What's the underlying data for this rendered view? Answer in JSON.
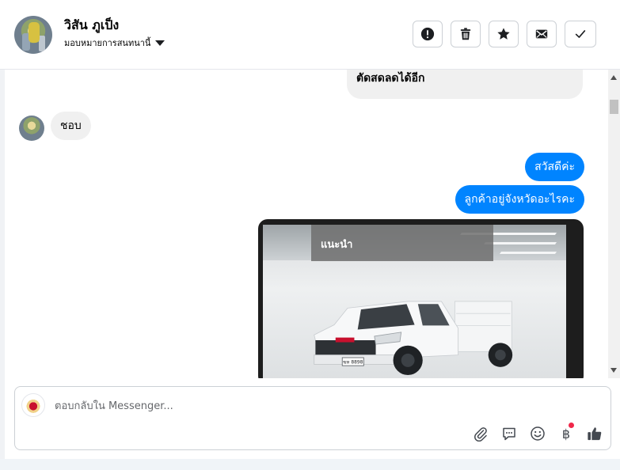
{
  "header": {
    "name": "วิสัน ภูเป็ง",
    "assign_label": "มอบหมายการสนทนานี้",
    "actions": [
      {
        "id": "mark-spam",
        "icon": "alert-icon"
      },
      {
        "id": "delete",
        "icon": "trash-icon"
      },
      {
        "id": "star",
        "icon": "star-icon"
      },
      {
        "id": "mark-unread",
        "icon": "envelope-icon"
      },
      {
        "id": "mark-done",
        "icon": "check-icon"
      }
    ]
  },
  "messages": [
    {
      "from": "customer-cut",
      "text": "ตัดสดลดได้อีก"
    },
    {
      "from": "contact",
      "text": "ชอบ"
    },
    {
      "from": "page",
      "text": "สวัสดีค่ะ"
    },
    {
      "from": "page",
      "text": "ลูกค้าอยู่จังหวัดอะไรคะ"
    }
  ],
  "card": {
    "badge": "แนะนำ",
    "plate_text": "ฆห 8898"
  },
  "composer": {
    "placeholder": "ตอบกลับใน Messenger...",
    "tools": [
      "paperclip-icon",
      "saved-reply-icon",
      "emoji-icon",
      "baht-icon",
      "thumbs-up-icon"
    ],
    "baht_symbol": "฿"
  },
  "colors": {
    "accent": "#0084ff",
    "incoming_bubble": "#f0f0f0",
    "notification_dot": "#f02849"
  }
}
